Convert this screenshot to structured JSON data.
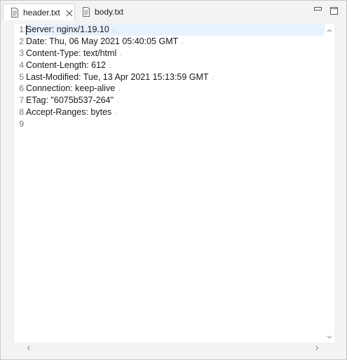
{
  "tabs": [
    {
      "label": "header.txt",
      "active": true
    },
    {
      "label": "body.txt",
      "active": false
    }
  ],
  "editor": {
    "line_numbers": [
      "1",
      "2",
      "3",
      "4",
      "5",
      "6",
      "7",
      "8",
      "9"
    ],
    "lines": [
      "Server: nginx/1.19.10",
      "Date: Thu, 06 May 2021 05:40:05 GMT",
      "Content-Type: text/html",
      "Content-Length: 612",
      "Last-Modified: Tue, 13 Apr 2021 15:13:59 GMT",
      "Connection: keep-alive",
      "ETag: \"6075b537-264\"",
      "Accept-Ranges: bytes",
      ""
    ],
    "eol_marker": "↓"
  },
  "icons": {
    "file": "file-text-icon",
    "close": "close-icon",
    "minimize": "minimize-icon",
    "maximize": "maximize-icon"
  },
  "colors": {
    "current_line": "#e8f2fe",
    "line_number": "#787878",
    "eol": "#c8c8c8"
  }
}
